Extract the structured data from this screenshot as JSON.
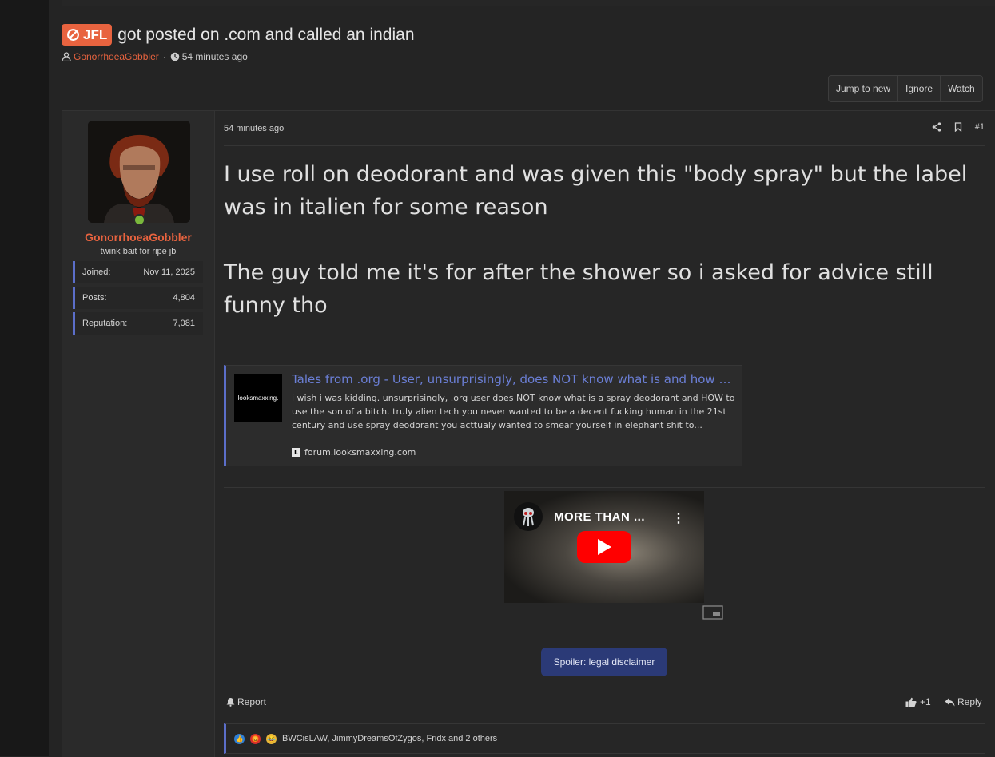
{
  "thread": {
    "prefix": "JFL",
    "title": "got posted on .com and called an indian",
    "author": "GonorrhoeaGobbler",
    "separator": "·",
    "time": "54 minutes ago"
  },
  "thread_buttons": {
    "jump_to_new": "Jump to new",
    "ignore": "Ignore",
    "watch": "Watch"
  },
  "user": {
    "name": "GonorrhoeaGobbler",
    "title": "twink bait for ripe jb",
    "status": "online",
    "stats": [
      {
        "label": "Joined:",
        "value": "Nov 11, 2025"
      },
      {
        "label": "Posts:",
        "value": "4,804"
      },
      {
        "label": "Reputation:",
        "value": "7,081"
      }
    ]
  },
  "post": {
    "date": "54 minutes ago",
    "number": "#1",
    "paragraph1": "I use roll on deodorant and was given this \"body spray\" but the label was in italien for some reason",
    "paragraph2": "The guy told me it's for after the shower so i asked for advice still funny tho"
  },
  "unfurl": {
    "logo_text": "looksmaxxing.",
    "title": "Tales from .org - User, unsurprisingly, does NOT know what is and how to use spray deodorant",
    "description": "i wish i was kidding. unsurprisingly, .org user does NOT know what is a spray deodorant and HOW to use the son of a bitch. truly alien tech you never wanted to be a decent fucking human in the 21st century and use spray deodorant you acttualy wanted to smear yourself in elephant shit to...",
    "favicon": "L",
    "domain": "forum.looksmaxxing.com"
  },
  "video": {
    "title": "MORE THAN ...",
    "menu": "⋮"
  },
  "spoiler_label": "Spoiler: legal disclaimer",
  "actions": {
    "report": "Report",
    "like_count": "+1",
    "reply": "Reply"
  },
  "reactions": {
    "text": "BWCisLAW, JimmyDreamsOfZygos, Fridx and 2 others"
  },
  "colors": {
    "accent": "#e8633f",
    "link": "#6b7fd6",
    "border_accent": "#5b6ec9",
    "spoiler": "#2b3a77",
    "online": "#7ab83c"
  }
}
